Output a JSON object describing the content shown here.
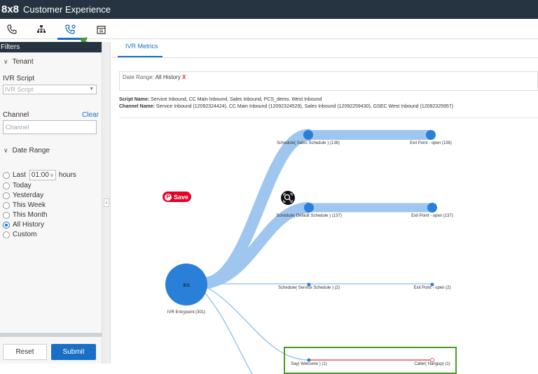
{
  "app": {
    "brand": "8x8",
    "title": "Customer Experience"
  },
  "nav": {
    "icons": [
      "phone-icon",
      "org-chart-icon",
      "call-settings-icon",
      "calendar-icon"
    ],
    "active_index": 2
  },
  "sidebar": {
    "header": "Filters",
    "tenant": {
      "heading": "Tenant"
    },
    "ivr_script": {
      "label": "IVR Script",
      "placeholder": "IVR Script"
    },
    "channel": {
      "label": "Channel",
      "clear": "Clear",
      "placeholder": "Channel"
    },
    "date_range": {
      "heading": "Date Range",
      "last_label": "Last",
      "last_value": "01:00",
      "hours_label": "hours",
      "options": [
        "Today",
        "Yesterday",
        "This Week",
        "This Month",
        "All History",
        "Custom"
      ],
      "selected": "All History"
    },
    "reset_label": "Reset",
    "submit_label": "Submit"
  },
  "main": {
    "tab_label": "IVR Metrics",
    "date_range_label": "Date Range:",
    "date_range_value": "All History",
    "date_range_remove": "X",
    "script_name_label": "Script Name:",
    "script_name_value": "Service Inbound, CC Main Inbound, Sales Inbound, PCS_demo, West Inbound",
    "channel_name_label": "Channel Name:",
    "channel_name_value": "Service Inbound (12092324424), CC Main Inbound (12092324529), Sales Inbound (12092259430), GSEC West Inbound (12092325957)"
  },
  "flow": {
    "entry": {
      "count": "301",
      "label": "IVR Entrypoint (301)"
    },
    "nodes": [
      {
        "from": "Schedule( Sales Schedule ) (138)",
        "to": "Exit Point - open (138)"
      },
      {
        "from": "Schedule( Default Schedule ) (137)",
        "to": "Exit Point - open (137)"
      },
      {
        "from": "Schedule( Service Schedule ) (2)",
        "to": "Exit Point - open (2)"
      },
      {
        "from": "Say( Welcome ) (1)",
        "to": "Caller( Hangup) (1)"
      }
    ]
  },
  "overlay": {
    "save_label": "Save"
  },
  "colors": {
    "accent": "#1a6fc4",
    "topbar": "#263441",
    "flow": "#9ec6ef",
    "node": "#2a7fd8",
    "hangup": "#e05a5a",
    "highlight": "#4a9a2a"
  }
}
